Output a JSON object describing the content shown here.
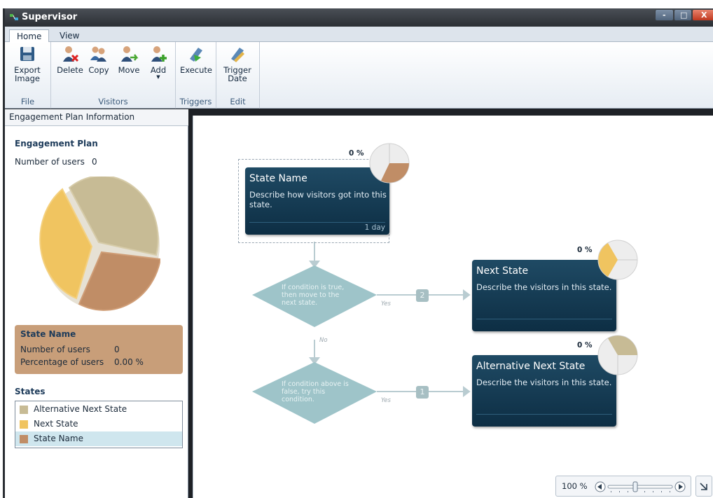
{
  "window": {
    "title": "Supervisor",
    "minimize": "-",
    "maximize": "□",
    "close": "X"
  },
  "ribbon": {
    "tabs": [
      {
        "label": "Home"
      },
      {
        "label": "View"
      }
    ],
    "groups": {
      "file": {
        "label": "File",
        "export": "Export Image"
      },
      "visitors": {
        "label": "Visitors",
        "delete": "Delete",
        "copy": "Copy",
        "move": "Move",
        "add": "Add"
      },
      "triggers": {
        "label": "Triggers",
        "execute": "Execute"
      },
      "edit": {
        "label": "Edit",
        "trigger_date": "Trigger Date"
      }
    }
  },
  "left_panel": {
    "header": "Engagement Plan Information",
    "title": "Engagement Plan",
    "num_users_label": "Number of users",
    "num_users_value": "0",
    "state_box": {
      "title": "State Name",
      "users_label": "Number of users",
      "users_value": "0",
      "pct_label": "Percentage of users",
      "pct_value": "0.00 %"
    },
    "states_title": "States",
    "states": [
      {
        "label": "Alternative Next State",
        "color": "#c7bb95"
      },
      {
        "label": "Next State",
        "color": "#f0c460"
      },
      {
        "label": "State Name",
        "color": "#c08d66"
      }
    ]
  },
  "canvas": {
    "node_state": {
      "title": "State Name",
      "desc": "Describe how visitors got into this state.",
      "footer": "1 day",
      "pct": "0 %"
    },
    "node_next": {
      "title": "Next State",
      "desc": "Describe the visitors in this state.",
      "pct": "0 %"
    },
    "node_alt": {
      "title": "Alternative Next State",
      "desc": "Describe the visitors in this state.",
      "pct": "0 %"
    },
    "condition1": {
      "text": "If condition is true, then move to the next state.",
      "yes": "Yes",
      "no": "No",
      "badge": "2"
    },
    "condition2": {
      "text": "If condition above is false, try this condition.",
      "yes": "Yes",
      "badge": "1"
    }
  },
  "zoom": {
    "label": "100 %"
  }
}
